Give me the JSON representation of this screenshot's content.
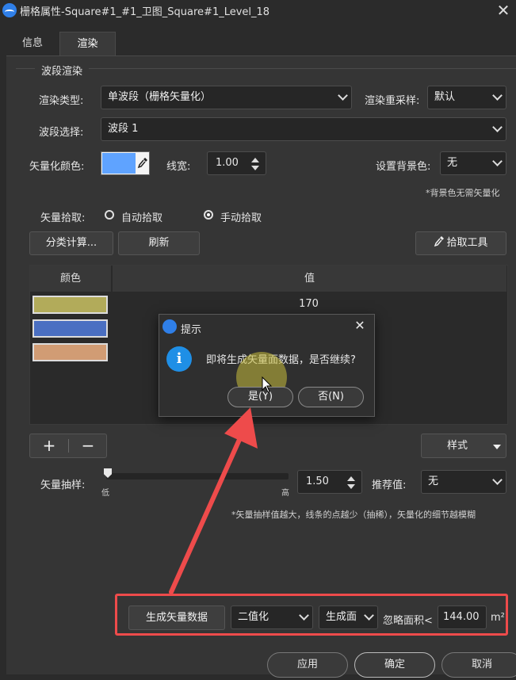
{
  "window": {
    "title": "栅格属性-Square#1_#1_卫图_Square#1_Level_18"
  },
  "tabs": [
    {
      "label": "信息"
    },
    {
      "label": "渲染"
    }
  ],
  "section": {
    "title": "波段渲染"
  },
  "render_type": {
    "label": "渲染类型:",
    "value": "单波段（栅格矢量化）"
  },
  "resample": {
    "label": "渲染重采样:",
    "value": "默认"
  },
  "band": {
    "label": "波段选择:",
    "value": "波段 1"
  },
  "vector_color": {
    "label": "矢量化颜色:",
    "color": "#5fa3ff",
    "picker_icon": "eyedropper-icon"
  },
  "line_width": {
    "label": "线宽:",
    "value": "1.00"
  },
  "bg_color": {
    "label": "设置背景色:",
    "value": "无",
    "note": "*背景色无需矢量化"
  },
  "pick": {
    "label": "矢量拾取:",
    "auto": "自动拾取",
    "manual": "手动拾取",
    "selected": "manual"
  },
  "toolbar": {
    "classify": "分类计算...",
    "refresh": "刷新",
    "pick_tool": "拾取工具"
  },
  "table": {
    "headers": [
      "颜色",
      "值"
    ],
    "rows": [
      {
        "color": "#b2ab5a",
        "value": "170"
      },
      {
        "color": "#4a6fc2",
        "value": ""
      },
      {
        "color": "#d19c74",
        "value": ""
      }
    ]
  },
  "table_tools": {
    "add": "+",
    "remove": "−",
    "style": "样式"
  },
  "sampling": {
    "label": "矢量抽样:",
    "low": "低",
    "high": "高",
    "value": "1.50",
    "level": 0.0
  },
  "recommend": {
    "label": "推荐值:",
    "value": "无"
  },
  "sampling_note": "*矢量抽样值越大，线条的点越少（抽稀），矢量化的细节越模糊",
  "dialog": {
    "title": "提示",
    "message": "即将生成矢量面数据，是否继续?",
    "yes": "是(Y)",
    "no": "否(N)"
  },
  "generate": {
    "button": "生成矢量数据",
    "mode": "二值化",
    "output": "生成面",
    "ignore_label": "忽略面积<",
    "ignore_value": "144.00",
    "unit": "m²"
  },
  "footer": {
    "apply": "应用",
    "ok": "确定",
    "cancel": "取消"
  },
  "colors": {
    "accent": "#1f8fe6",
    "annotation": "#ee4b4b"
  }
}
